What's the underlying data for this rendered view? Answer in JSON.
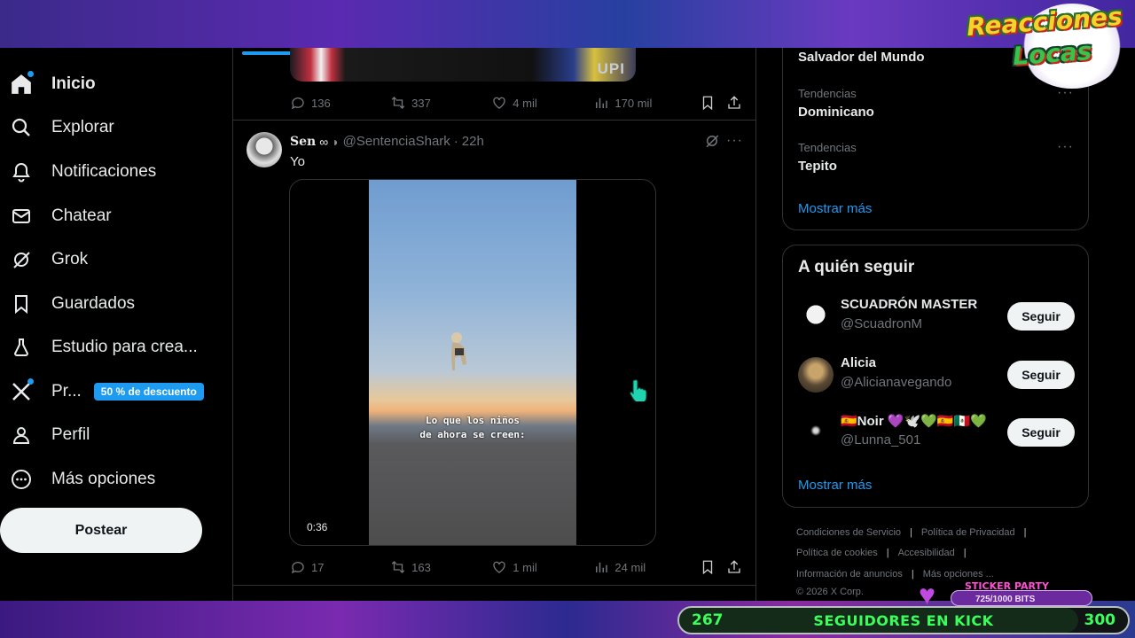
{
  "sidebar": {
    "items": [
      {
        "label": "Inicio",
        "icon": "home-icon"
      },
      {
        "label": "Explorar",
        "icon": "search-icon"
      },
      {
        "label": "Notificaciones",
        "icon": "bell-icon"
      },
      {
        "label": "Chatear",
        "icon": "mail-icon"
      },
      {
        "label": "Grok",
        "icon": "grok-icon"
      },
      {
        "label": "Guardados",
        "icon": "bookmark-icon"
      },
      {
        "label": "Estudio para crea...",
        "icon": "flask-icon"
      },
      {
        "label": "Pr...",
        "icon": "x-logo-icon",
        "badge": "50 % de descuento"
      },
      {
        "label": "Perfil",
        "icon": "person-icon"
      },
      {
        "label": "Más opciones",
        "icon": "more-circle-icon"
      }
    ],
    "post_button": "Postear"
  },
  "feed": {
    "prev_tweet": {
      "media_watermark": "UPI",
      "replies": "136",
      "retweets": "337",
      "likes": "4 mil",
      "views": "170 mil"
    },
    "tweet": {
      "name": "Sen",
      "handle": "@SentenciaShark",
      "time": "22h",
      "text": "Yo",
      "video_caption_line1": "Lo que los niños",
      "video_caption_line2": "de ahora se creen:",
      "video_time": "0:36",
      "replies": "17",
      "retweets": "163",
      "likes": "1 mil",
      "views": "24 mil"
    }
  },
  "right": {
    "trends_top_partial": "Salvador del Mundo",
    "trends": [
      {
        "category": "Tendencias",
        "title": "Dominicano"
      },
      {
        "category": "Tendencias",
        "title": "Tepito"
      }
    ],
    "trends_show_more": "Mostrar más",
    "who_to_follow": {
      "title": "A quién seguir",
      "accounts": [
        {
          "name": "SCUADRÓN MASTER",
          "handle": "@ScuadronM",
          "button": "Seguir"
        },
        {
          "name": "Alicia",
          "handle": "@Alicianavegando",
          "button": "Seguir"
        },
        {
          "name": "🇪🇸Noir 💜🕊️💚🇪🇸🇲🇽💚",
          "handle": "@Lunna_501",
          "button": "Seguir"
        }
      ],
      "show_more": "Mostrar más"
    },
    "footer": {
      "links_row1": [
        "Condiciones de Servicio",
        "Política de Privacidad"
      ],
      "links_row2": [
        "Política de cookies",
        "Accesibilidad"
      ],
      "links_row3": [
        "Información de anuncios",
        "Más opciones ..."
      ],
      "copyright": "© 2026 X Corp."
    }
  },
  "overlay": {
    "logo_line1": "Reacciones",
    "logo_line2": "Locas",
    "kick_current": "267",
    "kick_label": "SEGUIDORES EN KICK",
    "kick_goal": "300",
    "kick_progress": 0.89,
    "sticker_title": "STICKER PARTY",
    "sticker_bits": "725/1000 BITS"
  },
  "colors": {
    "accent": "#1d9bf0",
    "kick_green": "#3aff5a",
    "sticker_purple": "#6b2a9e"
  }
}
